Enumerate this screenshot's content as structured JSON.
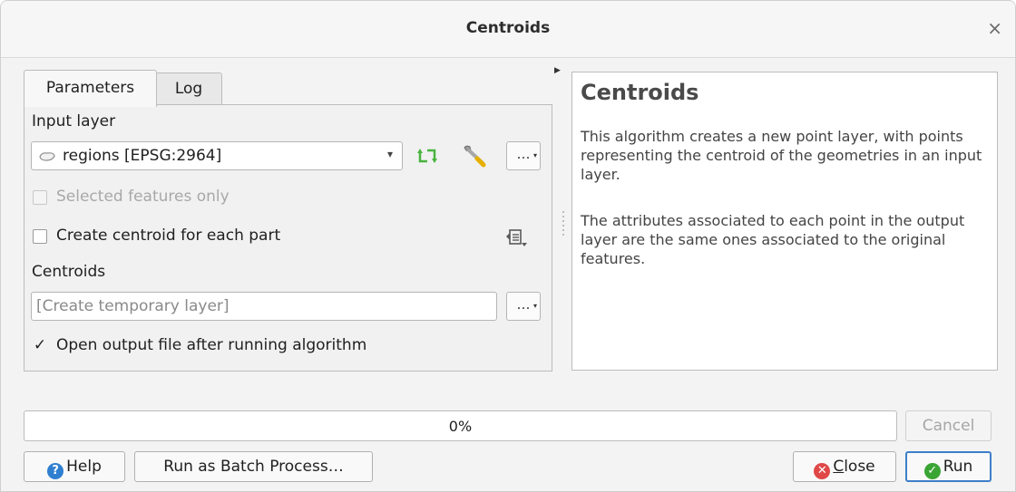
{
  "window": {
    "title": "Centroids",
    "close_icon": "×"
  },
  "tabs": [
    {
      "label": "Parameters",
      "active": true
    },
    {
      "label": "Log",
      "active": false
    }
  ],
  "params": {
    "input_layer_label": "Input layer",
    "input_layer_value": "regions [EPSG:2964]",
    "selected_only_label": "Selected features only",
    "selected_only_checked": false,
    "each_part_label": "Create centroid for each part",
    "each_part_checked": false,
    "output_label": "Centroids",
    "output_placeholder": "[Create temporary layer]",
    "open_output_label": "Open output file after running algorithm",
    "open_output_checked": true,
    "check_mark": "✓",
    "dots": "…",
    "combo_arrow": "▾"
  },
  "help": {
    "title": "Centroids",
    "paragraph1": "This algorithm creates a new point layer, with points representing the centroid of the geometries in an input layer.",
    "paragraph2": "The attributes associated to each point in the output layer are the same ones associated to the original features."
  },
  "progress": {
    "value": 0,
    "text": "0%"
  },
  "buttons": {
    "cancel": "Cancel",
    "help": "Help",
    "batch": "Run as Batch Process…",
    "close_first": "C",
    "close_rest": "lose",
    "run": "Run"
  },
  "icons": {
    "help_glyph": "?",
    "close_glyph": "✕",
    "run_glyph": "✓"
  },
  "colors": {
    "accent": "#3d7ec9",
    "help_icon": "#2f7fd1",
    "close_icon": "#e04848",
    "run_icon": "#3aa535"
  }
}
